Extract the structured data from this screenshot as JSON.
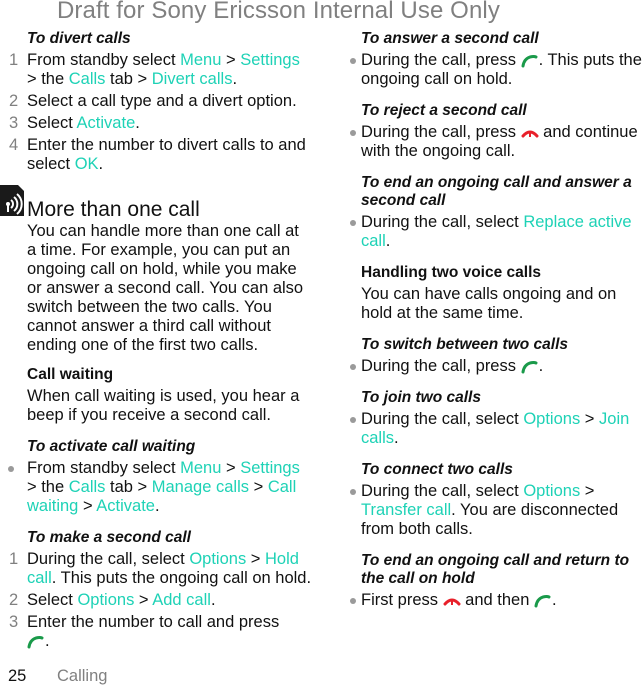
{
  "watermark": "Draft for Sony Ericsson Internal Use Only",
  "left": {
    "divert": {
      "heading": "To divert calls",
      "steps": [
        {
          "n": "1",
          "parts": [
            "From standby select ",
            "Menu",
            " > ",
            "Settings",
            " > the ",
            "Calls",
            " tab > ",
            "Divert calls",
            "."
          ]
        },
        {
          "n": "2",
          "text": "Select a call type and a divert option."
        },
        {
          "n": "3",
          "parts": [
            "Select ",
            "Activate",
            "."
          ]
        },
        {
          "n": "4",
          "parts": [
            "Enter the number to divert calls to and select ",
            "OK",
            "."
          ]
        }
      ]
    },
    "more": {
      "icon": "network-signal-icon",
      "heading": "More than one call",
      "body": "You can handle more than one call at a time. For example, you can put an ongoing call on hold, while you make or answer a second call. You can also switch between the two calls. You cannot answer a third call without ending one of the first two calls."
    },
    "waiting": {
      "heading": "Call waiting",
      "body": "When call waiting is used, you hear a beep if you receive a second call."
    },
    "activate": {
      "heading": "To activate call waiting",
      "parts": [
        "From standby select ",
        "Menu",
        " > ",
        "Settings",
        " > the ",
        "Calls",
        " tab > ",
        "Manage calls",
        " > ",
        "Call waiting",
        " > ",
        "Activate",
        "."
      ]
    },
    "make": {
      "heading": "To make a second call",
      "steps": [
        {
          "n": "1",
          "parts": [
            "During the call, select ",
            "Options",
            " > ",
            "Hold call",
            ". This puts the ongoing call on hold."
          ]
        },
        {
          "n": "2",
          "parts": [
            "Select ",
            "Options",
            " > ",
            "Add call",
            "."
          ]
        },
        {
          "n": "3",
          "text": "Enter the number to call and press",
          "icon": "call-key-icon",
          "after": "."
        }
      ]
    }
  },
  "right": {
    "answer": {
      "heading": "To answer a second call",
      "before": "During the call, press ",
      "after": ". This puts the ongoing call on hold."
    },
    "reject": {
      "heading": "To reject a second call",
      "before": "During the call, press ",
      "after": " and continue with the ongoing call."
    },
    "endanswer": {
      "heading": "To end an ongoing call and answer a second call",
      "before": "During the call, select ",
      "link": "Replace active call",
      "after": "."
    },
    "handling": {
      "heading": "Handling two voice calls",
      "body": "You can have calls ongoing and on hold at the same time."
    },
    "switch": {
      "heading": "To switch between two calls",
      "before": "During the call, press ",
      "after": "."
    },
    "join": {
      "heading": "To join two calls",
      "before": "During the call, select ",
      "link1": "Options",
      "sep": " > ",
      "link2": "Join calls",
      "after": "."
    },
    "connect": {
      "heading": "To connect two calls",
      "before": "During the call, select ",
      "link1": "Options",
      "sep": " > ",
      "link2": "Transfer call",
      "after": ". You are disconnected from both calls."
    },
    "endreturn": {
      "heading": "To end an ongoing call and return to the call on hold",
      "before": "First press ",
      "mid": " and then ",
      "after": "."
    }
  },
  "footer": {
    "page": "25",
    "section": "Calling"
  },
  "colors": {
    "link": "#1ed2b6",
    "call_green": "#1a9a4a",
    "end_red": "#e8202a",
    "muted": "#808080"
  }
}
